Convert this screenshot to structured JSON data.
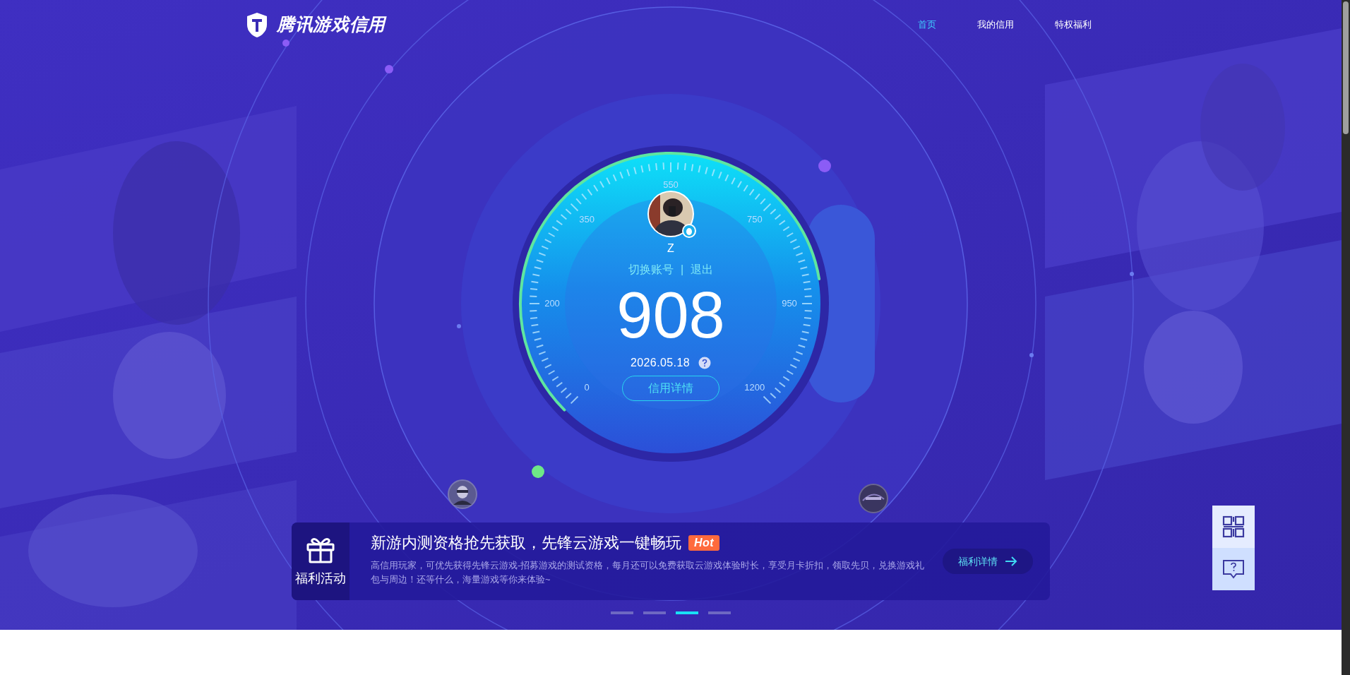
{
  "header": {
    "logo_text": "腾讯游戏信用",
    "nav": [
      {
        "label": "首页",
        "selected": true
      },
      {
        "label": "我的信用",
        "selected": false
      },
      {
        "label": "特权福利",
        "selected": false
      }
    ]
  },
  "gauge": {
    "scale_labels": [
      "0",
      "200",
      "350",
      "550",
      "750",
      "950",
      "1200"
    ],
    "username": "Z",
    "account_links": [
      "切换账号",
      "退出"
    ],
    "separator": "|",
    "score": "908",
    "date": "2026.05.18",
    "details_button": "信用详情"
  },
  "promo": {
    "category": "福利活动",
    "title": "新游内测资格抢先获取，先锋云游戏一键畅玩",
    "badge": "Hot",
    "description": "高信用玩家，可优先获得先锋云游戏-招募游戏的测试资格，每月还可以免费获取云游戏体验时长，享受月卡折扣，领取先贝，兑换游戏礼包与周边！还等什么，海量游戏等你来体验~",
    "button": "福利详情"
  },
  "carousel_dots": [
    {
      "selected": false
    },
    {
      "selected": false
    },
    {
      "selected": true
    },
    {
      "selected": false
    }
  ]
}
